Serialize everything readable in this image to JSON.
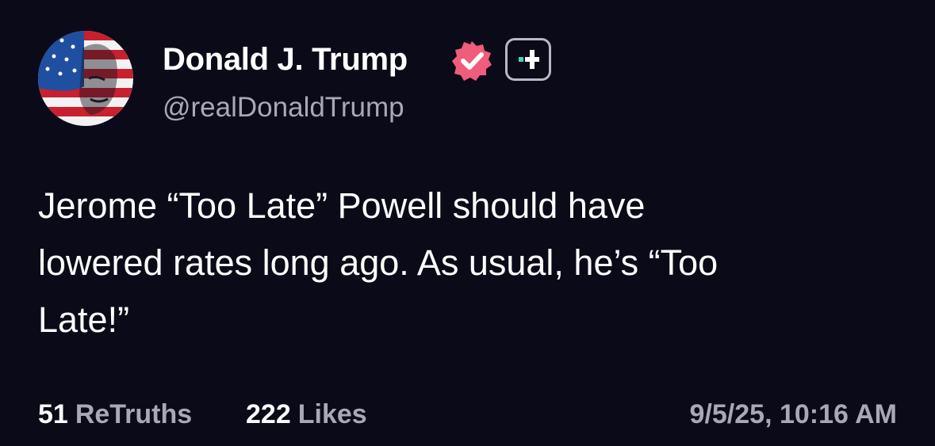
{
  "author": {
    "display_name": "Donald J. Trump",
    "handle": "@realDonaldTrump",
    "avatar": "flag-painted-portrait-avatar",
    "verified_icon": "verified-check-icon",
    "plus_icon": "plus-icon"
  },
  "post": {
    "lines": [
      "Jerome “Too Late” Powell should have",
      "lowered rates long ago. As usual, he’s “Too",
      "Late!”"
    ]
  },
  "stats": {
    "retruths_count": "51",
    "retruths_label": "ReTruths",
    "likes_count": "222",
    "likes_label": "Likes",
    "timestamp": "9/5/25, 10:16 AM"
  },
  "colors": {
    "background": "#0b0a19",
    "primary_text": "#ffffff",
    "secondary_text": "#a8a8b6",
    "verified_pink": "#f05c7b",
    "plus_accent": "#4fd1b8"
  }
}
